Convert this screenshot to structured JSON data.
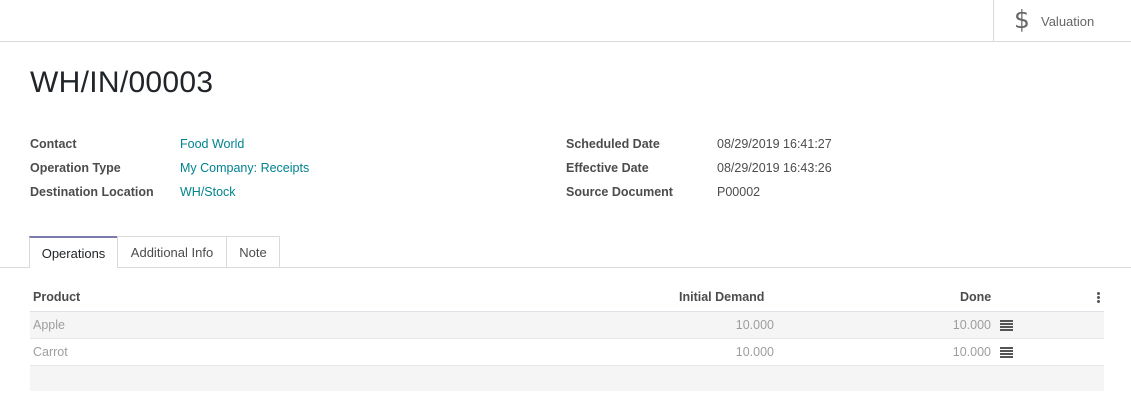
{
  "header": {
    "valuation_icon": "dollar-icon",
    "valuation_glyph": "$",
    "valuation_label": "Valuation"
  },
  "record": {
    "title": "WH/IN/00003"
  },
  "fields_left": [
    {
      "label": "Contact",
      "value": "Food World"
    },
    {
      "label": "Operation Type",
      "value": "My Company: Receipts"
    },
    {
      "label": "Destination Location",
      "value": "WH/Stock"
    }
  ],
  "fields_right": [
    {
      "label": "Scheduled Date",
      "value": "08/29/2019 16:41:27"
    },
    {
      "label": "Effective Date",
      "value": "08/29/2019 16:43:26"
    },
    {
      "label": "Source Document",
      "value": "P00002"
    }
  ],
  "tabs": [
    {
      "label": "Operations",
      "active": true
    },
    {
      "label": "Additional Info",
      "active": false
    },
    {
      "label": "Note",
      "active": false
    }
  ],
  "table": {
    "columns": [
      "Product",
      "Initial Demand",
      "Done"
    ],
    "rows": [
      {
        "product": "Apple",
        "initial_demand": "10.000",
        "done": "10.000"
      },
      {
        "product": "Carrot",
        "initial_demand": "10.000",
        "done": "10.000"
      }
    ]
  },
  "colors": {
    "link": "#00838f",
    "tab_active_border": "#7c7bad"
  }
}
